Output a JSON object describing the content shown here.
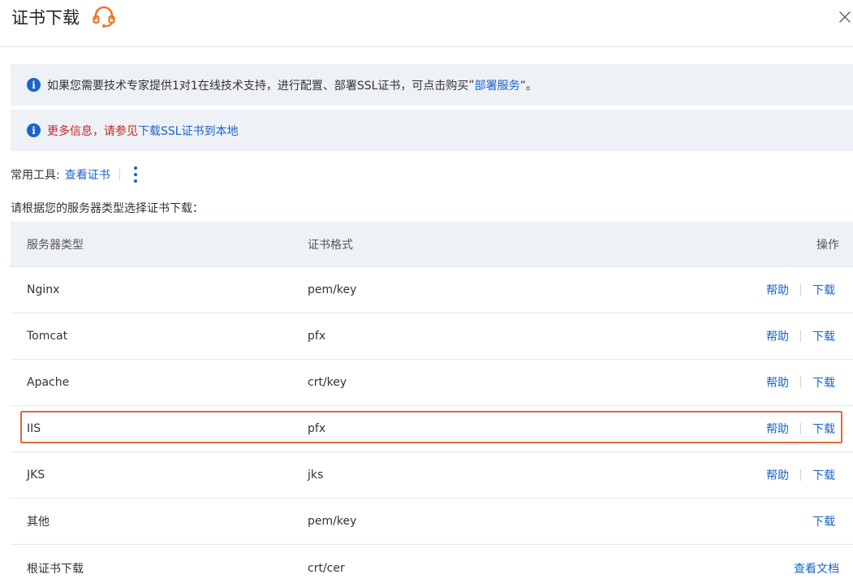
{
  "dialog": {
    "title": "证书下载",
    "colors": {
      "accent": "#1b63c8",
      "headset": "#f0762a",
      "highlight": "#e06a3a",
      "notice_bg": "#eef1f6",
      "warning_text": "#c0282b"
    }
  },
  "notices": {
    "first": {
      "text": "如果您需要技术专家提供1对1在线技术支持，进行配置、部署SSL证书，可点击购买",
      "quote_open": "“",
      "link": "部署服务",
      "quote_close": "”。"
    },
    "second": {
      "red_text": "更多信息，请参见",
      "link": "下载SSL证书到本地"
    }
  },
  "tools": {
    "label": "常用工具:",
    "link": "查看证书"
  },
  "prompt": "请根据您的服务器类型选择证书下载：",
  "table": {
    "headers": {
      "server_type": "服务器类型",
      "format": "证书格式",
      "actions": "操作"
    },
    "rows": [
      {
        "server": "Nginx",
        "format": "pem/key",
        "help": "帮助",
        "download": "下载"
      },
      {
        "server": "Tomcat",
        "format": "pfx",
        "help": "帮助",
        "download": "下载"
      },
      {
        "server": "Apache",
        "format": "crt/key",
        "help": "帮助",
        "download": "下载"
      },
      {
        "server": "IIS",
        "format": "pfx",
        "help": "帮助",
        "download": "下载"
      },
      {
        "server": "JKS",
        "format": "jks",
        "help": "帮助",
        "download": "下载"
      },
      {
        "server": "其他",
        "format": "pem/key",
        "download": "下载"
      },
      {
        "server": "根证书下载",
        "format": "crt/cer",
        "view_doc": "查看文档"
      }
    ]
  },
  "icons": {
    "headset": "headset-icon",
    "close": "close-icon",
    "info": "info-icon",
    "more": "more-vertical-icon"
  }
}
